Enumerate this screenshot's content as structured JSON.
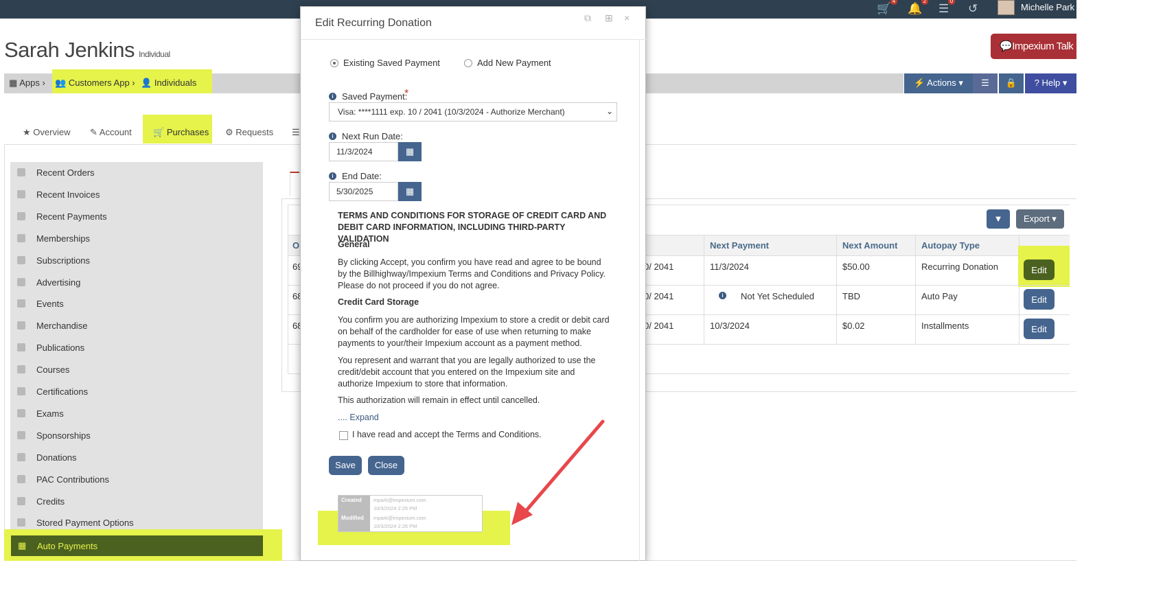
{
  "topbar": {
    "user_name": "Michelle Park",
    "badges": {
      "cart": "4",
      "bell": "2",
      "tasks": "0"
    }
  },
  "header": {
    "title": "Sarah Jenkins",
    "subtitle": "Individual",
    "talk_button": "Impexium Talk"
  },
  "breadcrumb": {
    "apps": "Apps",
    "customers": "Customers App",
    "individuals": "Individuals"
  },
  "toolbar": {
    "actions": "Actions",
    "help": "Help"
  },
  "tabs": [
    "Overview",
    "Account",
    "Purchases",
    "Requests"
  ],
  "sidebar": {
    "items": [
      "Recent Orders",
      "Recent Invoices",
      "Recent Payments",
      "Memberships",
      "Subscriptions",
      "Advertising",
      "Events",
      "Merchandise",
      "Publications",
      "Courses",
      "Certifications",
      "Exams",
      "Sponsorships",
      "Donations",
      "PAC Contributions",
      "Credits",
      "Stored Payment Options"
    ],
    "active": "Auto Payments"
  },
  "table": {
    "export": "Export",
    "first_col_header": "O",
    "headers": {
      "next_payment": "Next Payment",
      "next_amount": "Next Amount",
      "autopay_type": "Autopay Type"
    },
    "rows": [
      {
        "id_frag": "69",
        "exp_frag": "0/ 2041",
        "next_payment": "11/3/2024",
        "next_amount": "$50.00",
        "autopay_type": "Recurring Donation",
        "edit": "Edit"
      },
      {
        "id_frag": "68",
        "exp_frag": "0/ 2041",
        "next_payment": "Not Yet Scheduled",
        "next_amount": "TBD",
        "autopay_type": "Auto Pay",
        "edit": "Edit"
      },
      {
        "id_frag": "68",
        "exp_frag": "0/ 2041",
        "next_payment": "10/3/2024",
        "next_amount": "$0.02",
        "autopay_type": "Installments",
        "edit": "Edit"
      }
    ]
  },
  "modal": {
    "title": "Edit Recurring Donation",
    "radio_existing": "Existing Saved Payment",
    "radio_new": "Add New Payment",
    "saved_payment_label": "Saved Payment:",
    "required_mark": "*",
    "saved_payment_value": "Visa: ****1111 exp. 10 / 2041 (10/3/2024 - Authorize Merchant)",
    "next_run_label": "Next Run Date:",
    "next_run_value": "11/3/2024",
    "end_date_label": "End Date:",
    "end_date_value": "5/30/2025",
    "terms_title": "TERMS AND CONDITIONS FOR STORAGE OF CREDIT CARD AND DEBIT CARD INFORMATION, INCLUDING THIRD-PARTY VALIDATION",
    "general_heading": "General",
    "general_text": "By clicking Accept, you confirm you have read and agree to be bound by the Billhighway/Impexium Terms and Conditions and Privacy Policy. Please do not proceed if you do not agree.",
    "storage_heading": "Credit Card Storage",
    "storage_text1": "You confirm you are authorizing Impexium to store a credit or debit card on behalf of the cardholder for ease of use when returning to make payments to your/their Impexium account as a payment method.",
    "storage_text2": "You represent and warrant that you are legally authorized to use the credit/debit account that you entered on the Impexium site and authorize Impexium to store that information.",
    "storage_text3": "This authorization will remain in effect until cancelled.",
    "expand": ".... Expand",
    "accept_label": "I have read and accept the Terms and Conditions.",
    "save": "Save",
    "close": "Close",
    "audit": {
      "created_label": "Created",
      "created_by": "mpark@impexium.com",
      "created_at": "10/3/2024 2:25 PM",
      "modified_label": "Modified",
      "modified_by": "mpark@impexium.com",
      "modified_at": "10/3/2024 2:26 PM"
    }
  },
  "colors": {
    "topbar": "#2f4050",
    "primary": "#45658f",
    "highlight": "#e5f34a",
    "talk": "#a93036",
    "arrow": "#e8474b"
  }
}
